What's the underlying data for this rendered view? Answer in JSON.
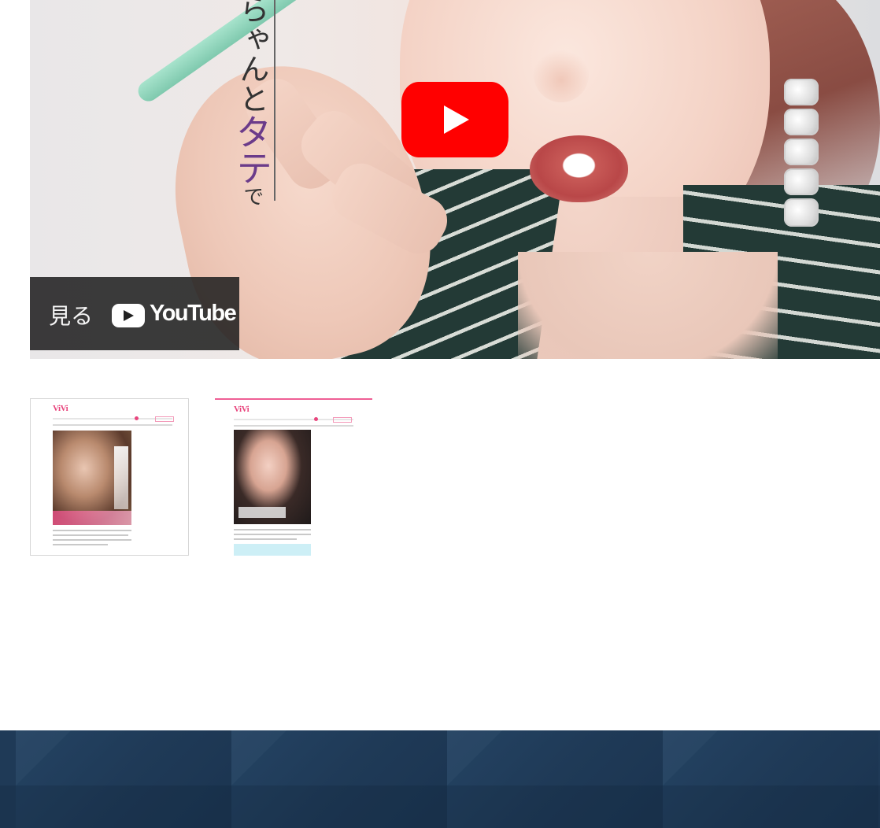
{
  "video": {
    "caption_top": "らゃんと",
    "caption_accent": "タテ",
    "caption_small": "で",
    "watch_label": "見る",
    "watch_brand": "YouTube",
    "play_color": "#ff0000"
  },
  "thumbnails": [
    {
      "logo": "ViVi",
      "selected": false
    },
    {
      "logo": "ViVi",
      "selected": true
    }
  ],
  "colors": {
    "accent_pink": "#ef5f95",
    "footer_bg": "#1f3a57"
  },
  "icons": [
    "youtube-play-icon",
    "youtube-logo-icon"
  ]
}
